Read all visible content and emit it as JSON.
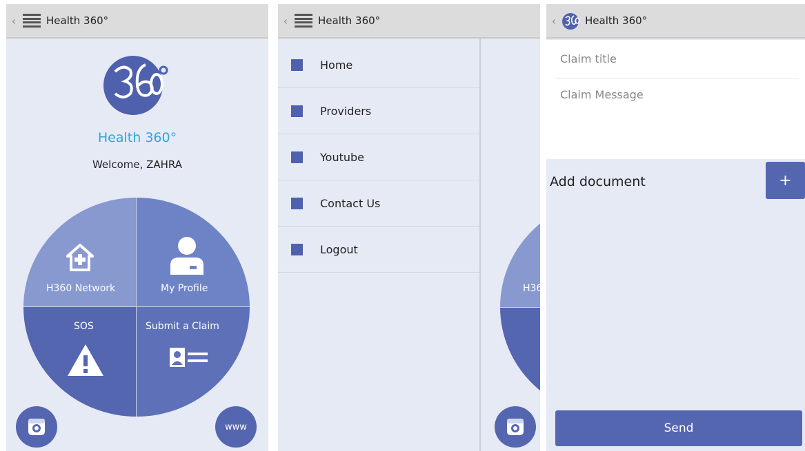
{
  "app_title": "Health 360°",
  "home": {
    "app_name": "Health 360°",
    "welcome": "Welcome, ZAHRA",
    "tiles": {
      "network": "H360 Network",
      "profile": "My Profile",
      "sos": "SOS",
      "claim": "Submit a Claim"
    },
    "www_label": "www",
    "icons": [
      "instagram-icon",
      "house-plus-icon",
      "person-icon",
      "warning-icon",
      "id-card-icon"
    ]
  },
  "drawer": {
    "items": [
      {
        "label": "Home"
      },
      {
        "label": "Providers"
      },
      {
        "label": "Youtube"
      },
      {
        "label": "Contact Us"
      },
      {
        "label": "Logout"
      }
    ],
    "peek_label": "H36"
  },
  "claim_form": {
    "title_placeholder": "Claim title",
    "message_placeholder": "Claim Message",
    "add_document_label": "Add document",
    "add_button_label": "+",
    "send_label": "Send"
  },
  "colors": {
    "primary": "#5566b0",
    "background": "#e6eaf5",
    "topbar": "#dcdcdc",
    "accent_text": "#2da7d8"
  }
}
